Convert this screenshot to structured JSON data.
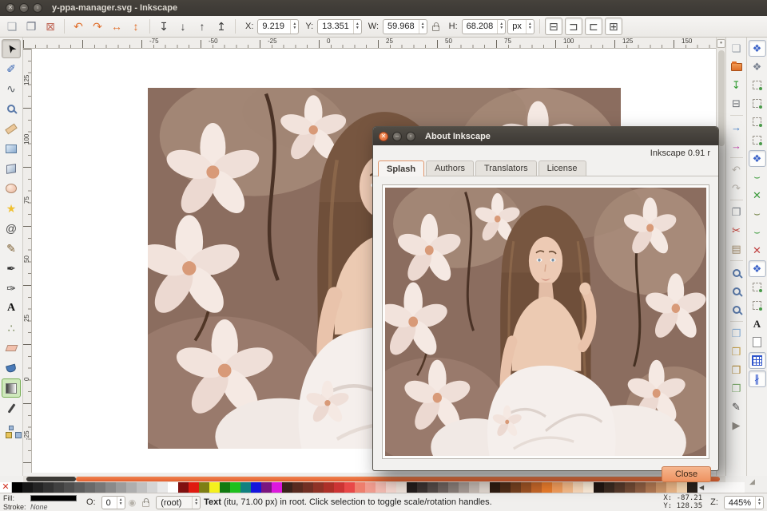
{
  "window": {
    "title": "y-ppa-manager.svg - Inkscape"
  },
  "toolbar": {
    "icons": [
      {
        "name": "select-all-icon",
        "glyph": "❏",
        "color": "#9aa0a8"
      },
      {
        "name": "select-all-layers-icon",
        "glyph": "❐",
        "color": "#6b7280"
      },
      {
        "name": "deselect-icon",
        "glyph": "⊠",
        "color": "#c06858"
      },
      {
        "sep": true
      },
      {
        "name": "rotate-ccw-icon",
        "glyph": "↶",
        "color": "#e0702e"
      },
      {
        "name": "rotate-cw-icon",
        "glyph": "↷",
        "color": "#e0702e"
      },
      {
        "name": "flip-horizontal-icon",
        "glyph": "↔",
        "color": "#e0702e"
      },
      {
        "name": "flip-vertical-icon",
        "glyph": "↕",
        "color": "#e0702e"
      },
      {
        "sep": true
      },
      {
        "name": "lower-to-bottom-icon",
        "glyph": "↧",
        "color": "#3a3a3a"
      },
      {
        "name": "lower-one-step-icon",
        "glyph": "↓",
        "color": "#3a3a3a"
      },
      {
        "name": "raise-one-step-icon",
        "glyph": "↑",
        "color": "#3a3a3a"
      },
      {
        "name": "raise-to-top-icon",
        "glyph": "↥",
        "color": "#3a3a3a"
      }
    ],
    "affect_icons": [
      {
        "name": "move-as-group-icon",
        "glyph": "⊟",
        "color": "#4a4a4a",
        "active": true
      },
      {
        "name": "affect-stroke-icon",
        "glyph": "⊐",
        "color": "#4a4a4a",
        "active": true
      },
      {
        "name": "affect-corners-icon",
        "glyph": "⊏",
        "color": "#4a4a4a",
        "active": true
      },
      {
        "name": "affect-patterns-icon",
        "glyph": "⊞",
        "color": "#4a4a4a",
        "active": true
      }
    ],
    "x_label": "X:",
    "x_value": "9.219",
    "y_label": "Y:",
    "y_value": "13.351",
    "w_label": "W:",
    "w_value": "59.968",
    "h_label": "H:",
    "h_value": "68.208",
    "unit": "px"
  },
  "toolbox": {
    "tools": [
      {
        "name": "selector-tool-icon",
        "glyph": "➤",
        "color": "#111",
        "rot": -125,
        "active": true
      },
      {
        "name": "node-editor-tool-icon",
        "glyph": "✐",
        "color": "#2f5fb0"
      },
      {
        "name": "tweak-tool-icon",
        "glyph": "∿",
        "color": "#5a6066"
      },
      {
        "name": "zoom-tool-icon",
        "css": "mag"
      },
      {
        "name": "measure-tool-icon",
        "css": "ruler-chip"
      },
      {
        "name": "rectangle-tool-icon",
        "css": "rect-chip"
      },
      {
        "name": "box3d-tool-icon",
        "css": "box3d-chip"
      },
      {
        "name": "ellipse-tool-icon",
        "css": "ell-chip"
      },
      {
        "name": "star-tool-icon",
        "glyph": "★",
        "color": "#f0c030"
      },
      {
        "name": "spiral-tool-icon",
        "glyph": "@",
        "color": "#4a4a4a"
      },
      {
        "name": "pencil-tool-icon",
        "glyph": "✎",
        "color": "#7a5c2e"
      },
      {
        "name": "bezier-pen-tool-icon",
        "glyph": "✒",
        "color": "#333"
      },
      {
        "name": "calligraphy-tool-icon",
        "glyph": "✑",
        "color": "#333"
      },
      {
        "name": "text-tool-icon",
        "glyph": "A",
        "color": "#111"
      },
      {
        "name": "spray-tool-icon",
        "glyph": "∴",
        "color": "#7a8a5a"
      },
      {
        "name": "eraser-tool-icon",
        "css": "eraser-chip"
      },
      {
        "name": "paint-bucket-tool-icon",
        "css": "bucket-chip"
      },
      {
        "name": "gradient-tool-icon",
        "css": "grad-chip",
        "activeGreen": true
      },
      {
        "name": "dropper-tool-icon",
        "css": "drop-chip"
      },
      {
        "name": "connector-tool-icon",
        "css": "conn-chip"
      }
    ]
  },
  "commands_bar": {
    "items": [
      {
        "name": "new-document-icon",
        "glyph": "❏",
        "color": "#98a0aa"
      },
      {
        "name": "open-document-icon",
        "css": "folder-chip"
      },
      {
        "name": "save-document-icon",
        "glyph": "↧",
        "color": "#2f9a2f"
      },
      {
        "name": "print-icon",
        "glyph": "⊟",
        "color": "#6a6e74"
      },
      {
        "sep": true
      },
      {
        "name": "import-icon",
        "glyph": "→",
        "color": "#3a78c8"
      },
      {
        "name": "export-icon",
        "glyph": "→",
        "color": "#c03aa8"
      },
      {
        "sep": true
      },
      {
        "name": "undo-icon",
        "glyph": "↶",
        "color": "#b9b5ae"
      },
      {
        "name": "redo-icon",
        "glyph": "↷",
        "color": "#b9b5ae"
      },
      {
        "sep": true
      },
      {
        "name": "copy-icon",
        "glyph": "❐",
        "color": "#7a8088"
      },
      {
        "name": "cut-icon",
        "glyph": "✂",
        "color": "#c24038"
      },
      {
        "name": "paste-icon",
        "glyph": "▤",
        "color": "#a08a6a"
      },
      {
        "sep": true
      },
      {
        "name": "zoom-selection-icon",
        "css": "mag"
      },
      {
        "name": "zoom-drawing-icon",
        "css": "mag"
      },
      {
        "name": "zoom-page-icon",
        "css": "mag"
      },
      {
        "sep": true
      },
      {
        "name": "duplicate-icon",
        "glyph": "❐",
        "color": "#8ab0d8"
      },
      {
        "name": "create-clone-icon",
        "glyph": "❒",
        "color": "#c8a24a"
      },
      {
        "name": "unlink-clone-icon",
        "glyph": "❒",
        "color": "#b08a3a"
      },
      {
        "name": "group-objects-icon",
        "glyph": "❐",
        "color": "#7aa86a"
      },
      {
        "name": "fill-stroke-dialog-icon",
        "glyph": "✎",
        "color": "#444"
      },
      {
        "name": "commands-overflow-arrow-icon",
        "glyph": "▶",
        "color": "#8a867f"
      }
    ]
  },
  "snap_bar": {
    "items": [
      {
        "name": "snap-enable-icon",
        "glyph": "❖",
        "color": "#3a62c8",
        "active": true
      },
      {
        "name": "snap-bbox-icon",
        "glyph": "❖",
        "color": "#7a8290"
      },
      {
        "name": "snap-bbox-edges-icon",
        "css": "dash-chip"
      },
      {
        "name": "snap-bbox-corners-icon",
        "css": "dash-chip"
      },
      {
        "name": "snap-bbox-midpoints-icon",
        "css": "dash-chip"
      },
      {
        "name": "snap-bbox-centers-icon",
        "css": "dash-chip"
      },
      {
        "name": "snap-nodes-icon",
        "glyph": "❖",
        "color": "#3a62c8",
        "active": true
      },
      {
        "name": "snap-path-icon",
        "glyph": "⌣",
        "color": "#3a9a3a"
      },
      {
        "name": "snap-path-intersections-icon",
        "glyph": "✕",
        "color": "#3a9a3a"
      },
      {
        "name": "snap-cusp-nodes-icon",
        "glyph": "⌣",
        "color": "#6a7a3a"
      },
      {
        "name": "snap-smooth-nodes-icon",
        "glyph": "⌣",
        "color": "#3a9a3a"
      },
      {
        "name": "snap-midpoints-icon",
        "glyph": "✕",
        "color": "#c04040"
      },
      {
        "name": "snap-object-centers-icon",
        "glyph": "❖",
        "color": "#3a62c8",
        "active": true
      },
      {
        "name": "snap-rotation-centers-icon",
        "css": "dash-chip"
      },
      {
        "name": "snap-node-corner-icon",
        "css": "dash-chip"
      },
      {
        "name": "snap-text-baseline-icon",
        "glyph": "A",
        "color": "#222"
      },
      {
        "name": "snap-page-border-icon",
        "css": "page-chip"
      },
      {
        "name": "snap-grid-icon",
        "css": "grid-chip",
        "active": true
      },
      {
        "name": "snap-guides-icon",
        "glyph": "∦",
        "color": "#2f55cc",
        "active": true
      }
    ]
  },
  "rulers": {
    "top": [
      "-75",
      "-50",
      "-25",
      "0",
      "25",
      "50",
      "75",
      "100",
      "125",
      "150"
    ],
    "left": [
      "125",
      "100",
      "75",
      "50",
      "25",
      "0",
      "-25"
    ]
  },
  "dialog": {
    "title": "About Inkscape",
    "version": "Inkscape 0.91 r",
    "tabs": [
      "Splash",
      "Authors",
      "Translators",
      "License"
    ],
    "active_tab": "Splash",
    "close_label": "Close"
  },
  "palette": {
    "colors": [
      "#000000",
      "#161616",
      "#242424",
      "#323232",
      "#404040",
      "#4e4e4e",
      "#5c5c5c",
      "#6a6a6a",
      "#787878",
      "#8a8a8a",
      "#9c9c9c",
      "#aeaeae",
      "#c0c0c0",
      "#d4d4d4",
      "#e8e8e8",
      "#ffffff",
      "#801010",
      "#e01a10",
      "#7e7e14",
      "#f5f01e",
      "#117a11",
      "#1ec01e",
      "#108080",
      "#1515dd",
      "#7a1580",
      "#dd18dd",
      "#3a221c",
      "#582a20",
      "#712f24",
      "#8f3226",
      "#ad3028",
      "#cc3434",
      "#e84848",
      "#ef7f6e",
      "#f29d90",
      "#f5bdb3",
      "#f8d9d1",
      "#f2e5dd",
      "#231d1c",
      "#3b3331",
      "#544b48",
      "#6d625e",
      "#887d78",
      "#a69a94",
      "#c5bab3",
      "#e1d7cf",
      "#2d1c11",
      "#4f2d18",
      "#754120",
      "#9d5325",
      "#c66729",
      "#eb7d2d",
      "#f49e5c",
      "#f8bc8a",
      "#fbdabb",
      "#fdeeda",
      "#211712",
      "#3b2b21",
      "#563a2b",
      "#724b35",
      "#905f43",
      "#b27953",
      "#d09769",
      "#edb889",
      "#f9d8b1",
      "#2a211c"
    ]
  },
  "statusbar": {
    "fill_label": "Fill:",
    "stroke_label": "Stroke:",
    "stroke_value": "None",
    "opacity_label": "O:",
    "opacity_value": "0",
    "layer_value": "(root)",
    "message_strong": "Text",
    "message": " (itu, 71.00 px) in root. Click selection to toggle scale/rotation handles.",
    "x_label": "X:",
    "x_value": "-87.21",
    "y_label": "Y:",
    "y_value": "128.35",
    "z_label": "Z:",
    "zoom_value": "445%"
  },
  "accent_colors": {
    "orange": "#e8643c",
    "titlebar": "#3f3b37",
    "pressed_blue": "#3a62c8"
  }
}
